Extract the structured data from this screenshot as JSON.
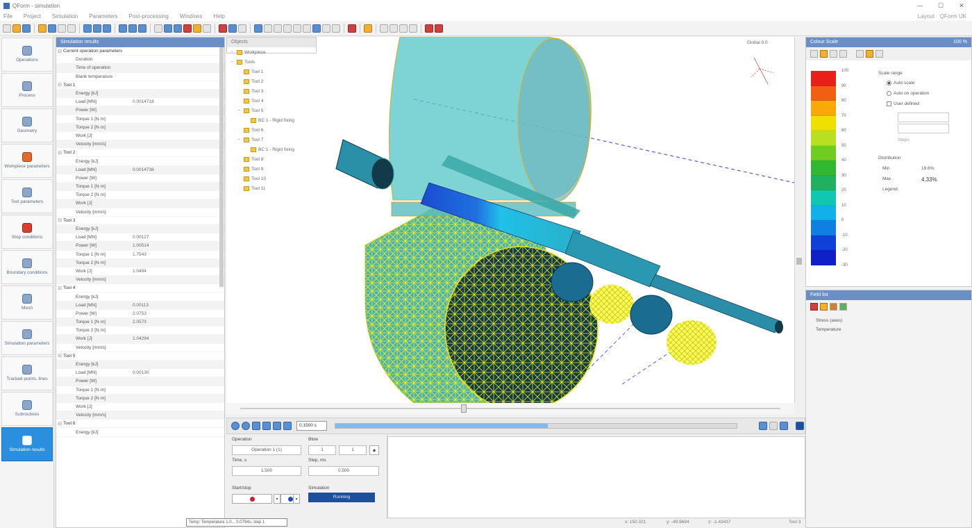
{
  "window": {
    "title": "QForm - simulation",
    "controls": [
      "—",
      "☐",
      "✕"
    ]
  },
  "menu": {
    "items": [
      "File",
      "Project",
      "Simulation",
      "Parameters",
      "Post-processing",
      "Windows",
      "Help"
    ],
    "right": [
      "Layout",
      "QForm UK"
    ]
  },
  "nav": {
    "items": [
      {
        "label": "Operations",
        "icon": "operations-icon"
      },
      {
        "label": "Process",
        "icon": "process-icon"
      },
      {
        "label": "Geometry",
        "icon": "geometry-icon"
      },
      {
        "label": "Workpiece parameters",
        "icon": "workpiece-icon"
      },
      {
        "label": "Tool parameters",
        "icon": "tool-icon"
      },
      {
        "label": "Stop conditions",
        "icon": "stop-icon"
      },
      {
        "label": "Boundary conditions",
        "icon": "boundary-icon"
      },
      {
        "label": "Mesh",
        "icon": "mesh-icon"
      },
      {
        "label": "Simulation parameters",
        "icon": "sim-params-icon"
      },
      {
        "label": "Tracked points, lines",
        "icon": "tracking-icon"
      },
      {
        "label": "Subroutines",
        "icon": "subroutines-icon"
      },
      {
        "label": "Simulation results",
        "icon": "results-icon"
      }
    ],
    "active_index": 11
  },
  "params": {
    "title": "Simulation results",
    "groups": [
      {
        "name": "Current operation parameters",
        "rows": [
          {
            "k": "Duration",
            "v": ""
          },
          {
            "k": "Time of operation",
            "v": ""
          },
          {
            "k": "Blank temperature",
            "v": ""
          }
        ]
      },
      {
        "name": "Tool 1",
        "rows": [
          {
            "k": "Energy [kJ]",
            "v": ""
          },
          {
            "k": "Load [MN]",
            "v": "0.0014718"
          },
          {
            "k": "Power [W]",
            "v": ""
          },
          {
            "k": "Torque 1 [N·m]",
            "v": ""
          },
          {
            "k": "Torque 2 [N·m]",
            "v": ""
          },
          {
            "k": "Work [J]",
            "v": ""
          },
          {
            "k": "Velocity [mm/s]",
            "v": ""
          }
        ]
      },
      {
        "name": "Tool 2",
        "rows": [
          {
            "k": "Energy [kJ]",
            "v": ""
          },
          {
            "k": "Load [MN]",
            "v": "0.0014738"
          },
          {
            "k": "Power [W]",
            "v": ""
          },
          {
            "k": "Torque 1 [N·m]",
            "v": ""
          },
          {
            "k": "Torque 2 [N·m]",
            "v": ""
          },
          {
            "k": "Work [J]",
            "v": ""
          },
          {
            "k": "Velocity [mm/s]",
            "v": ""
          }
        ]
      },
      {
        "name": "Tool 3",
        "rows": [
          {
            "k": "Energy [kJ]",
            "v": ""
          },
          {
            "k": "Load [MN]",
            "v": "0.00127"
          },
          {
            "k": "Power [W]",
            "v": "1.00514"
          },
          {
            "k": "Torque 1 [N·m]",
            "v": "1.7543"
          },
          {
            "k": "Torque 2 [N·m]",
            "v": ""
          },
          {
            "k": "Work [J]",
            "v": "1.0494"
          },
          {
            "k": "Velocity [mm/s]",
            "v": ""
          }
        ]
      },
      {
        "name": "Tool 4",
        "rows": [
          {
            "k": "Energy [kJ]",
            "v": ""
          },
          {
            "k": "Load [MN]",
            "v": "0.00113"
          },
          {
            "k": "Power [W]",
            "v": "2.0753"
          },
          {
            "k": "Torque 1 [N·m]",
            "v": "2.0573"
          },
          {
            "k": "Torque 2 [N·m]",
            "v": ""
          },
          {
            "k": "Work [J]",
            "v": "1.04294"
          },
          {
            "k": "Velocity [mm/s]",
            "v": ""
          }
        ]
      },
      {
        "name": "Tool 5",
        "rows": [
          {
            "k": "Energy [kJ]",
            "v": ""
          },
          {
            "k": "Load [MN]",
            "v": "0.00130"
          },
          {
            "k": "Power [W]",
            "v": ""
          },
          {
            "k": "Torque 1 [N·m]",
            "v": ""
          },
          {
            "k": "Torque 2 [N·m]",
            "v": ""
          },
          {
            "k": "Work [J]",
            "v": ""
          },
          {
            "k": "Velocity [mm/s]",
            "v": ""
          }
        ]
      },
      {
        "name": "Tool 6",
        "rows": [
          {
            "k": "Energy [kJ]",
            "v": ""
          }
        ]
      }
    ]
  },
  "objects": {
    "title": "Objects",
    "tree": [
      {
        "label": "Workpiece",
        "level": 0,
        "exp": "−"
      },
      {
        "label": "Tools",
        "level": 0,
        "exp": "−"
      },
      {
        "label": "Tool 1",
        "level": 1,
        "exp": ""
      },
      {
        "label": "Tool 2",
        "level": 1,
        "exp": ""
      },
      {
        "label": "Tool 3",
        "level": 1,
        "exp": ""
      },
      {
        "label": "Tool 4",
        "level": 1,
        "exp": ""
      },
      {
        "label": "Tool 5",
        "level": 1,
        "exp": "−"
      },
      {
        "label": "BC 1 - Rigid fixing",
        "level": 2,
        "exp": ""
      },
      {
        "label": "Tool 6",
        "level": 1,
        "exp": ""
      },
      {
        "label": "Tool 7",
        "level": 1,
        "exp": "−"
      },
      {
        "label": "BC 1 - Rigid fixing",
        "level": 2,
        "exp": ""
      },
      {
        "label": "Tool 8",
        "level": 1,
        "exp": ""
      },
      {
        "label": "Tool 9",
        "level": 1,
        "exp": ""
      },
      {
        "label": "Tool 10",
        "level": 1,
        "exp": ""
      },
      {
        "label": "Tool 11",
        "level": 1,
        "exp": ""
      }
    ]
  },
  "viewport": {
    "coord_label": "Global 0:0"
  },
  "playback": {
    "time": "0.1500 s",
    "progress": 0.53
  },
  "controls": {
    "operation_label": "Operation",
    "operation_value": "Operation 1 (1)",
    "blows_label": "Blow",
    "blow_value": "1",
    "blow_of": "1",
    "time_label": "Time, s",
    "time_value": "1.500",
    "step_label": "Step, ms",
    "step_value": "0.500",
    "mode_label": "Start/stop",
    "state_label": "Simulation",
    "state_value": "Running"
  },
  "tooltip": "Temp: Temperature 1.0... 0.0794s, step 1",
  "status": {
    "x": "x: 150.321",
    "y": "y: -49.9694",
    "z": "z: -1.43437",
    "tool": "Tool 3"
  },
  "legend": {
    "title": "Colour Scale",
    "value": "100 %",
    "colors": [
      "#e82018",
      "#f06010",
      "#f8a808",
      "#f0e000",
      "#b8e020",
      "#70cc20",
      "#30b830",
      "#20b060",
      "#10c8b0",
      "#10b0e8",
      "#1080e0",
      "#1040d8",
      "#1020c8"
    ],
    "ticks": [
      "100",
      "90",
      "80",
      "70",
      "60",
      "50",
      "40",
      "30",
      "20",
      "10",
      "0",
      "-10",
      "-20",
      "-30"
    ],
    "range_title": "Scale range",
    "opt1": "Auto scale",
    "opt2": "Auto on operation",
    "opt3": "User defined",
    "min_label": "Min",
    "max_label": "Max",
    "min_val": "19.6%",
    "max_val": "4.33%",
    "sect_title": "Distribution",
    "extra": "Legend",
    "steps_label": "Steps"
  },
  "fields": {
    "title": "Field list",
    "items": [
      "Stress (axes)",
      "Temperature"
    ]
  }
}
